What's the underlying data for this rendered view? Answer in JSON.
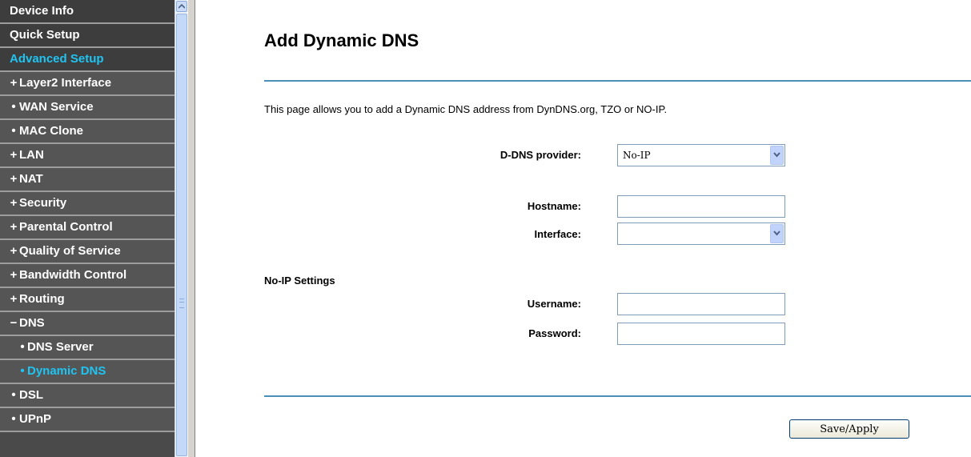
{
  "sidebar": {
    "items": [
      {
        "label": "Device Info",
        "marker": ""
      },
      {
        "label": "Quick Setup",
        "marker": ""
      },
      {
        "label": "Advanced Setup",
        "marker": ""
      },
      {
        "label": "Layer2 Interface",
        "marker": "+"
      },
      {
        "label": "WAN Service",
        "marker": "•"
      },
      {
        "label": "MAC Clone",
        "marker": "•"
      },
      {
        "label": "LAN",
        "marker": "+"
      },
      {
        "label": "NAT",
        "marker": "+"
      },
      {
        "label": "Security",
        "marker": "+"
      },
      {
        "label": "Parental Control",
        "marker": "+"
      },
      {
        "label": "Quality of Service",
        "marker": "+"
      },
      {
        "label": "Bandwidth Control",
        "marker": "+"
      },
      {
        "label": "Routing",
        "marker": "+"
      },
      {
        "label": "DNS",
        "marker": "−"
      },
      {
        "label": "DNS Server",
        "marker": "•"
      },
      {
        "label": "Dynamic DNS",
        "marker": "•"
      },
      {
        "label": "DSL",
        "marker": "•"
      },
      {
        "label": "UPnP",
        "marker": "•"
      }
    ],
    "active_color": "#1fc4f2"
  },
  "main": {
    "title": "Add Dynamic DNS",
    "description": "This page allows you to add a Dynamic DNS address from DynDNS.org, TZO or NO-IP.",
    "provider": {
      "label": "D-DNS provider:",
      "value": "No-IP"
    },
    "hostname": {
      "label": "Hostname:",
      "value": ""
    },
    "interface": {
      "label": "Interface:",
      "value": ""
    },
    "section_heading": "No-IP Settings",
    "username": {
      "label": "Username:",
      "value": ""
    },
    "password": {
      "label": "Password:",
      "value": ""
    },
    "save_label": "Save/Apply"
  }
}
